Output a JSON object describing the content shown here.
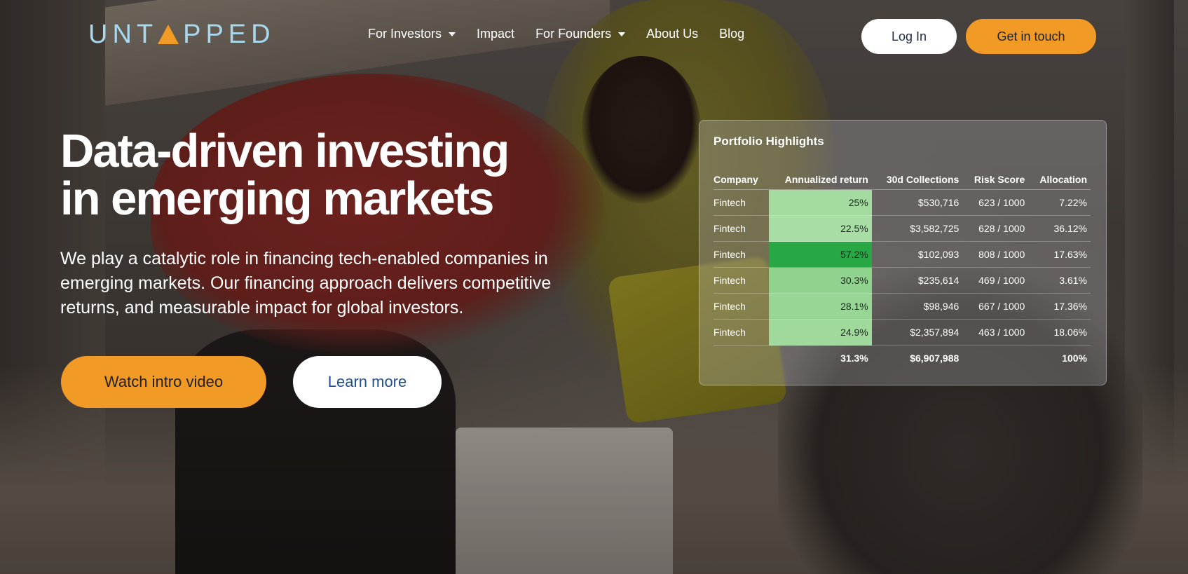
{
  "brand": {
    "logo_pre": "UNT",
    "logo_post": "PPED",
    "accent_color": "#f29a26",
    "logo_color": "#a9d8ee"
  },
  "nav": {
    "items": [
      {
        "label": "For Investors",
        "has_dropdown": true
      },
      {
        "label": "Impact",
        "has_dropdown": false
      },
      {
        "label": "For Founders",
        "has_dropdown": true
      },
      {
        "label": "About Us",
        "has_dropdown": false
      },
      {
        "label": "Blog",
        "has_dropdown": false
      }
    ],
    "login_label": "Log In",
    "contact_label": "Get in touch"
  },
  "hero": {
    "title_line1": "Data-driven investing",
    "title_line2": "in emerging markets",
    "subtitle": "We play a catalytic role in financing tech-enabled companies in emerging markets. Our financing approach delivers competitive returns, and measurable impact for global investors.",
    "video_button": "Watch intro video",
    "learn_button": "Learn more"
  },
  "portfolio": {
    "title": "Portfolio Highlights",
    "columns": [
      "Company",
      "Annualized return",
      "30d Collections",
      "Risk Score",
      "Allocation"
    ],
    "rows": [
      {
        "company": "Fintech",
        "return": "25%",
        "return_color": "#a3dba0",
        "collections": "$530,716",
        "risk": "623 / 1000",
        "allocation": "7.22%"
      },
      {
        "company": "Fintech",
        "return": "22.5%",
        "return_color": "#a8dda5",
        "collections": "$3,582,725",
        "risk": "628 / 1000",
        "allocation": "36.12%"
      },
      {
        "company": "Fintech",
        "return": "57.2%",
        "return_color": "#28a745",
        "collections": "$102,093",
        "risk": "808 / 1000",
        "allocation": "17.63%"
      },
      {
        "company": "Fintech",
        "return": "30.3%",
        "return_color": "#90d38e",
        "collections": "$235,614",
        "risk": "469 / 1000",
        "allocation": "3.61%"
      },
      {
        "company": "Fintech",
        "return": "28.1%",
        "return_color": "#97d695",
        "collections": "$98,946",
        "risk": "667 / 1000",
        "allocation": "17.36%"
      },
      {
        "company": "Fintech",
        "return": "24.9%",
        "return_color": "#9fda9c",
        "collections": "$2,357,894",
        "risk": "463 / 1000",
        "allocation": "18.06%"
      }
    ],
    "total": {
      "return": "31.3%",
      "collections": "$6,907,988",
      "allocation": "100%"
    }
  }
}
